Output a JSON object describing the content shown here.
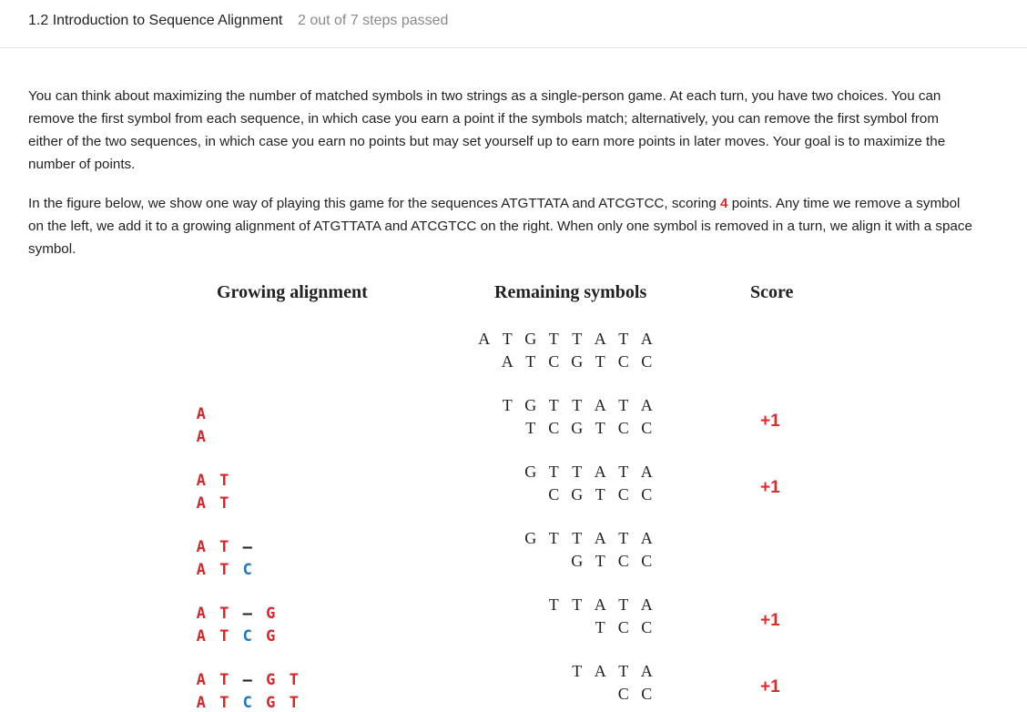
{
  "header": {
    "title": "1.2 Introduction to Sequence Alignment",
    "steps": "2 out of 7 steps passed"
  },
  "paragraph1": "You can think about maximizing the number of matched symbols in two strings as a single-person game. At each turn, you have two choices. You can remove the first symbol from each sequence, in which case you earn a point if the symbols match; alternatively, you can remove the first symbol from either of the two sequences, in which case you earn no points but may set yourself up to earn more points in later moves. Your goal is to maximize the number of points.",
  "paragraph2": {
    "before": "In the figure below, we show one way of playing this game for the sequences ATGTTATA and ATCGTCC, scoring ",
    "score": "4",
    "after": " points. Any time we remove a symbol on the left, we add it to a growing alignment of ATGTTATA and ATCGTCC on the right. When only one symbol is removed in a turn, we align it with a space symbol."
  },
  "figure": {
    "headers": {
      "alignment": "Growing alignment",
      "remaining": "Remaining symbols",
      "score": "Score"
    },
    "rows": [
      {
        "top_aln": [],
        "bottom_aln": [],
        "top_rem": [
          "A",
          "T",
          "G",
          "T",
          "T",
          "A",
          "T",
          "A"
        ],
        "bottom_rem": [
          "A",
          "T",
          "C",
          "G",
          "T",
          "C",
          "C"
        ],
        "score": ""
      },
      {
        "top_aln": [
          {
            "c": "A",
            "col": "red"
          }
        ],
        "bottom_aln": [
          {
            "c": "A",
            "col": "red"
          }
        ],
        "top_rem": [
          "T",
          "G",
          "T",
          "T",
          "A",
          "T",
          "A"
        ],
        "bottom_rem": [
          "T",
          "C",
          "G",
          "T",
          "C",
          "C"
        ],
        "score": "+1"
      },
      {
        "top_aln": [
          {
            "c": "A",
            "col": "red"
          },
          {
            "c": "T",
            "col": "red"
          }
        ],
        "bottom_aln": [
          {
            "c": "A",
            "col": "red"
          },
          {
            "c": "T",
            "col": "red"
          }
        ],
        "top_rem": [
          "G",
          "T",
          "T",
          "A",
          "T",
          "A"
        ],
        "bottom_rem": [
          "C",
          "G",
          "T",
          "C",
          "C"
        ],
        "score": "+1"
      },
      {
        "top_aln": [
          {
            "c": "A",
            "col": "red"
          },
          {
            "c": "T",
            "col": "red"
          },
          {
            "c": "–",
            "col": "blue"
          }
        ],
        "bottom_aln": [
          {
            "c": "A",
            "col": "red"
          },
          {
            "c": "T",
            "col": "red"
          },
          {
            "c": "C",
            "col": "blue"
          }
        ],
        "top_rem": [
          "G",
          "T",
          "T",
          "A",
          "T",
          "A"
        ],
        "bottom_rem": [
          "G",
          "T",
          "C",
          "C"
        ],
        "score": ""
      },
      {
        "top_aln": [
          {
            "c": "A",
            "col": "red"
          },
          {
            "c": "T",
            "col": "red"
          },
          {
            "c": "–",
            "col": "blue"
          },
          {
            "c": "G",
            "col": "red"
          }
        ],
        "bottom_aln": [
          {
            "c": "A",
            "col": "red"
          },
          {
            "c": "T",
            "col": "red"
          },
          {
            "c": "C",
            "col": "blue"
          },
          {
            "c": "G",
            "col": "red"
          }
        ],
        "top_rem": [
          "T",
          "T",
          "A",
          "T",
          "A"
        ],
        "bottom_rem": [
          "T",
          "C",
          "C"
        ],
        "score": "+1"
      },
      {
        "top_aln": [
          {
            "c": "A",
            "col": "red"
          },
          {
            "c": "T",
            "col": "red"
          },
          {
            "c": "–",
            "col": "blue"
          },
          {
            "c": "G",
            "col": "red"
          },
          {
            "c": "T",
            "col": "red"
          }
        ],
        "bottom_aln": [
          {
            "c": "A",
            "col": "red"
          },
          {
            "c": "T",
            "col": "red"
          },
          {
            "c": "C",
            "col": "blue"
          },
          {
            "c": "G",
            "col": "red"
          },
          {
            "c": "T",
            "col": "red"
          }
        ],
        "top_rem": [
          "T",
          "A",
          "T",
          "A"
        ],
        "bottom_rem": [
          "C",
          "C"
        ],
        "score": "+1"
      }
    ]
  }
}
